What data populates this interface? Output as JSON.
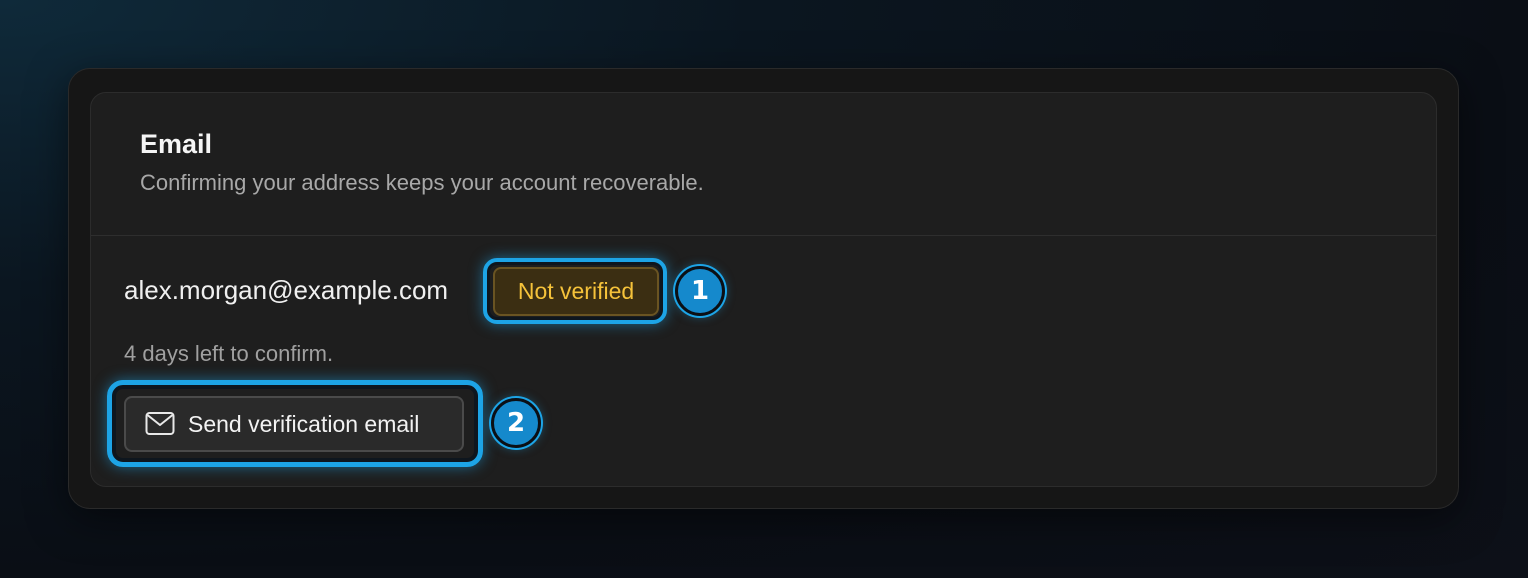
{
  "section": {
    "title": "Email",
    "description": "Confirming your address keeps your account recoverable."
  },
  "account": {
    "email": "alex.morgan@example.com",
    "status_label": "Not verified",
    "deadline_text": "4 days left to confirm."
  },
  "actions": {
    "send_label": "Send verification email",
    "send_icon": "mail-icon"
  },
  "callouts": [
    "1",
    "2"
  ],
  "colors": {
    "accent_highlight": "#1da4e6",
    "warning_text": "#f5c23a",
    "warning_bg": "#3b2e12",
    "card_bg": "#1e1e1e"
  }
}
